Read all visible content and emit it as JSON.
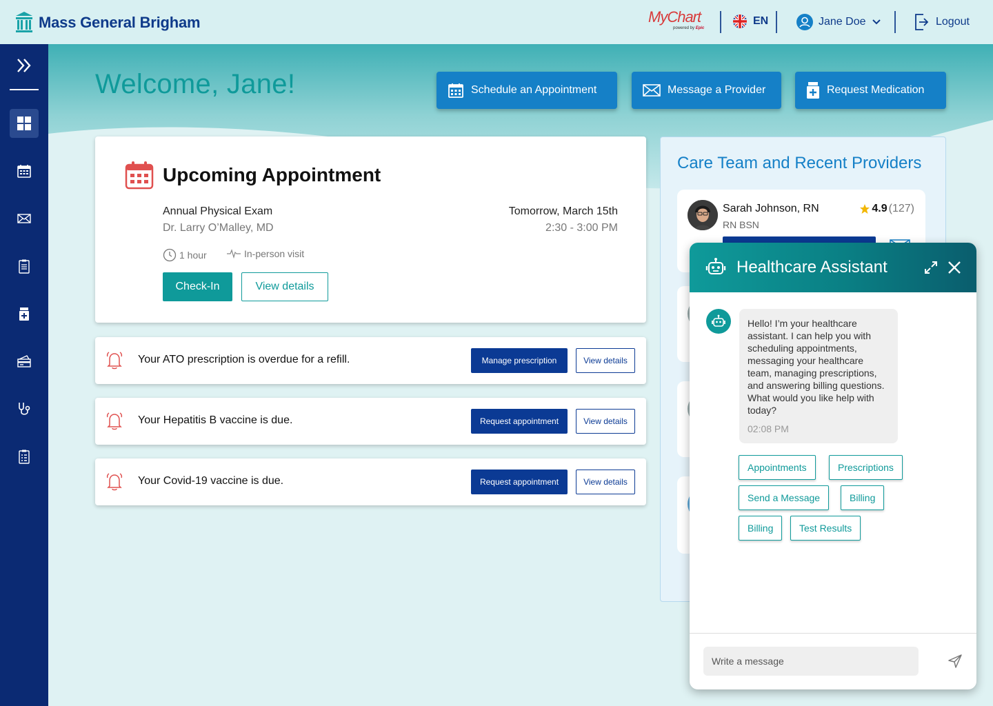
{
  "header": {
    "brand_name": "Mass General Brigham",
    "mychart_label": "MyChart",
    "mychart_powered": "powered by",
    "mychart_epic": "Epic",
    "language": "EN",
    "user_name": "Jane Doe",
    "logout_label": "Logout"
  },
  "sidebar": {
    "items": [
      {
        "name": "expand-icon"
      },
      {
        "name": "dashboard-icon"
      },
      {
        "name": "calendar-icon"
      },
      {
        "name": "mail-icon"
      },
      {
        "name": "clipboard-icon"
      },
      {
        "name": "medication-icon"
      },
      {
        "name": "billing-icon"
      },
      {
        "name": "stethoscope-icon"
      },
      {
        "name": "records-icon"
      }
    ]
  },
  "main": {
    "welcome": "Welcome, Jane!",
    "actions": [
      {
        "label": "Schedule an Appointment",
        "icon": "calendar-icon"
      },
      {
        "label": "Message a Provider",
        "icon": "mail-icon"
      },
      {
        "label": "Request Medication",
        "icon": "medication-icon"
      }
    ],
    "appointment": {
      "title": "Upcoming Appointment",
      "name": "Annual Physical Exam",
      "doctor": "Dr. Larry O’Malley, MD",
      "date": "Tomorrow, March 15th",
      "time": "2:30 - 3:00 PM",
      "duration": "1 hour",
      "visit_type": "In-person visit",
      "checkin_label": "Check-In",
      "details_label": "View details"
    },
    "alerts": [
      {
        "text": "Your ATO prescription is overdue for a refill.",
        "primary": "Manage prescription",
        "secondary": "View details"
      },
      {
        "text": "Your Hepatitis B vaccine is due.",
        "primary": "Request appointment",
        "secondary": "View details"
      },
      {
        "text": "Your Covid-19 vaccine is due.",
        "primary": "Request appointment",
        "secondary": "View details"
      }
    ]
  },
  "care_team": {
    "title": "Care Team and Recent Providers",
    "providers": [
      {
        "name": "Sarah Johnson, RN",
        "role": "RN BSN",
        "rating": "4.9",
        "count": "(127)"
      }
    ]
  },
  "chat": {
    "title": "Healthcare Assistant",
    "message": "Hello! I’m your healthcare assistant. I can help you with scheduling appointments, messaging your healthcare team, managing prescriptions, and answering billing questions. What would you like help with today?",
    "time": "02:08 PM",
    "chips": [
      "Appointments",
      "Prescriptions",
      "Send a Message",
      "Billing",
      "Billing",
      "Test Results"
    ],
    "input_placeholder": "Write a message"
  },
  "colors": {
    "brand_navy": "#0b2a73",
    "teal": "#0f9a9a",
    "action_blue": "#1580c7",
    "alert_red": "#e0504f"
  }
}
